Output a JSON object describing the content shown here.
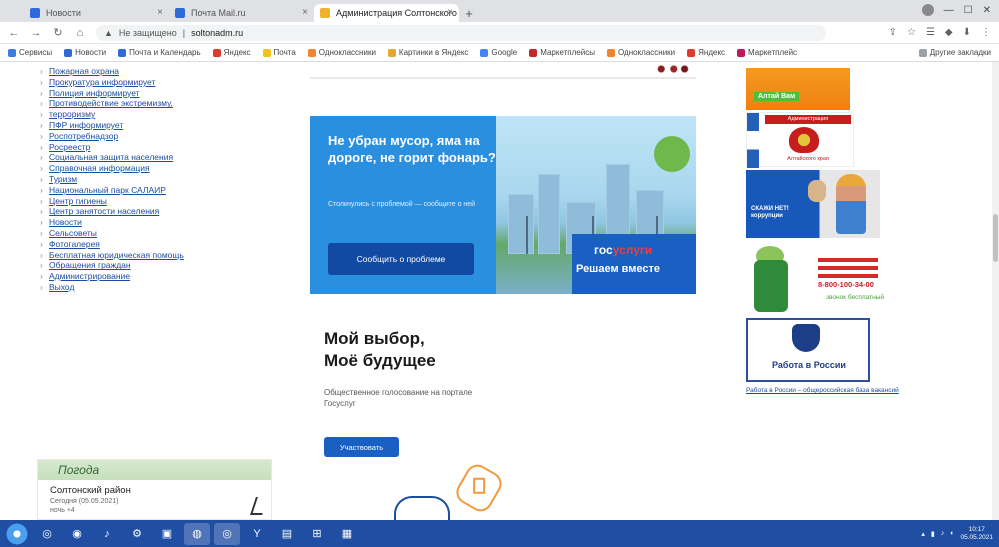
{
  "browser": {
    "tabs": [
      {
        "label": "Новости",
        "color": "#2e6ad8",
        "active": false
      },
      {
        "label": "Почта Mail.ru",
        "color": "#2e6ad8",
        "active": false
      },
      {
        "label": "Администрация Солтонского р…",
        "color": "#f0b22b",
        "active": true
      }
    ],
    "new_tab": "+",
    "address": {
      "security": "Не защищено",
      "url": "soltonadm.ru"
    },
    "bookmarks": [
      {
        "label": "Сервисы",
        "color": "#3c7be0"
      },
      {
        "label": "Новости",
        "color": "#2e6ad8"
      },
      {
        "label": "Почта и Календарь",
        "color": "#2e6ad8"
      },
      {
        "label": "Яндекс",
        "color": "#e13a2b"
      },
      {
        "label": "Почта",
        "color": "#f5c11e"
      },
      {
        "label": "Одноклассники",
        "color": "#f0852b"
      },
      {
        "label": "Картинки в Яндекс",
        "color": "#e0a72b"
      },
      {
        "label": "Google",
        "color": "#4285f4"
      },
      {
        "label": "Маркетплейсы",
        "color": "#c62828"
      },
      {
        "label": "Одноклассники",
        "color": "#f0852b"
      },
      {
        "label": "Яндекс",
        "color": "#e13a2b"
      },
      {
        "label": "Маркетплейс",
        "color": "#c2185b"
      }
    ],
    "bookmarks_other": "Другие закладки"
  },
  "left_nav": {
    "items": [
      "Пожарная охрана",
      "Прокуратура информирует",
      "Полиция информирует",
      "Противодействие экстремизму,",
      "терроризму",
      "ПФР информирует",
      "Роспотребнадзор",
      "Росреестр",
      "Социальная защита населения",
      "Справочная информация",
      "Туризм",
      "Национальный парк САЛАИР",
      "Центр гигиены",
      "Центр занятости населения",
      "Новости",
      "Сельсоветы",
      "Фотогалерея",
      "Бесплатная юридическая помощь",
      "Обращения граждан",
      "Администрирование",
      "Выход"
    ]
  },
  "weather": {
    "title": "Погода",
    "region": "Солтонский район",
    "date": "Сегодня (05.05.2021)",
    "temp": "ночь +4"
  },
  "gosuslugi_banner": {
    "title": "Не убран мусор, яма на дороге, не горит фонарь?",
    "subtitle": "Столкнулись с проблемой — сообщите о ней",
    "button": "Сообщить о проблеме",
    "logo_part1": "гос",
    "logo_part2": "услуги",
    "tagline": "Решаем вместе"
  },
  "vote_card": {
    "title_line1": "Мой выбор,",
    "title_line2": "Моё будущее",
    "subtitle": "Общественное голосование на портале Госуслуг",
    "button": "Участвовать"
  },
  "ads": {
    "ad1_caption": "Алтай Вам",
    "ad2_caption_top": "Администрация",
    "ad2_caption_bottom": "Алтайского края",
    "ad3_caption": "СКАЖИ НЕТ! коррупции",
    "ad4_number": "8-800-100-34-00",
    "ad4_sub": "звонок бесплатный",
    "ad5_caption": "Работа в России",
    "ad5_link": "Работа в России – общероссийская база вакансий"
  },
  "taskbar": {
    "apps": [
      "◎",
      "◉",
      "♪",
      "⚙",
      "▣",
      "◍",
      "◎",
      "Y",
      "▤",
      "⊞",
      "▦"
    ],
    "clock_time": "10:17",
    "clock_date": "05.05.2021"
  }
}
